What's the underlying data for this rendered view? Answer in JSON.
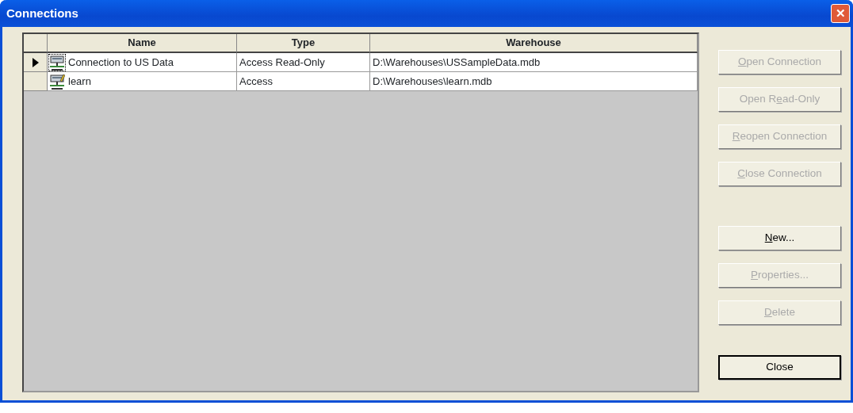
{
  "window": {
    "title": "Connections",
    "close_button": "✕"
  },
  "table": {
    "columns": [
      "Name",
      "Type",
      "Warehouse"
    ],
    "rows": [
      {
        "selected": true,
        "kind": "connection",
        "cells": [
          "Connection to US Data",
          "Access Read-Only",
          "D:\\Warehouses\\USSampleData.mdb"
        ]
      },
      {
        "selected": false,
        "kind": "connection-edit",
        "cells": [
          "learn",
          "Access",
          "D:\\Warehouses\\learn.mdb"
        ]
      }
    ]
  },
  "buttons": [
    {
      "label_parts": [
        {
          "text": "O",
          "underlined": true
        },
        {
          "text": "pen Connection",
          "underlined": false
        }
      ],
      "disabled": true,
      "default": false
    },
    {
      "label_parts": [
        {
          "text": "Open R",
          "underlined": false
        },
        {
          "text": "e",
          "underlined": true
        },
        {
          "text": "ad-Only",
          "underlined": false
        }
      ],
      "disabled": true,
      "default": false
    },
    {
      "label_parts": [
        {
          "text": "R",
          "underlined": true
        },
        {
          "text": "eopen Connection",
          "underlined": false
        }
      ],
      "disabled": true,
      "default": false
    },
    {
      "label_parts": [
        {
          "text": "C",
          "underlined": true
        },
        {
          "text": "lose Connection",
          "underlined": false
        }
      ],
      "disabled": true,
      "default": false
    },
    {
      "label_parts": [
        {
          "text": "N",
          "underlined": true
        },
        {
          "text": "ew...",
          "underlined": false
        }
      ],
      "disabled": false,
      "default": false
    },
    {
      "label_parts": [
        {
          "text": "P",
          "underlined": true
        },
        {
          "text": "roperties...",
          "underlined": false
        }
      ],
      "disabled": true,
      "default": false
    },
    {
      "label_parts": [
        {
          "text": "D",
          "underlined": true
        },
        {
          "text": "elete",
          "underlined": false
        }
      ],
      "disabled": true,
      "default": false
    },
    {
      "label_parts": [
        {
          "text": "Close",
          "underlined": false
        }
      ],
      "disabled": false,
      "default": true
    }
  ]
}
